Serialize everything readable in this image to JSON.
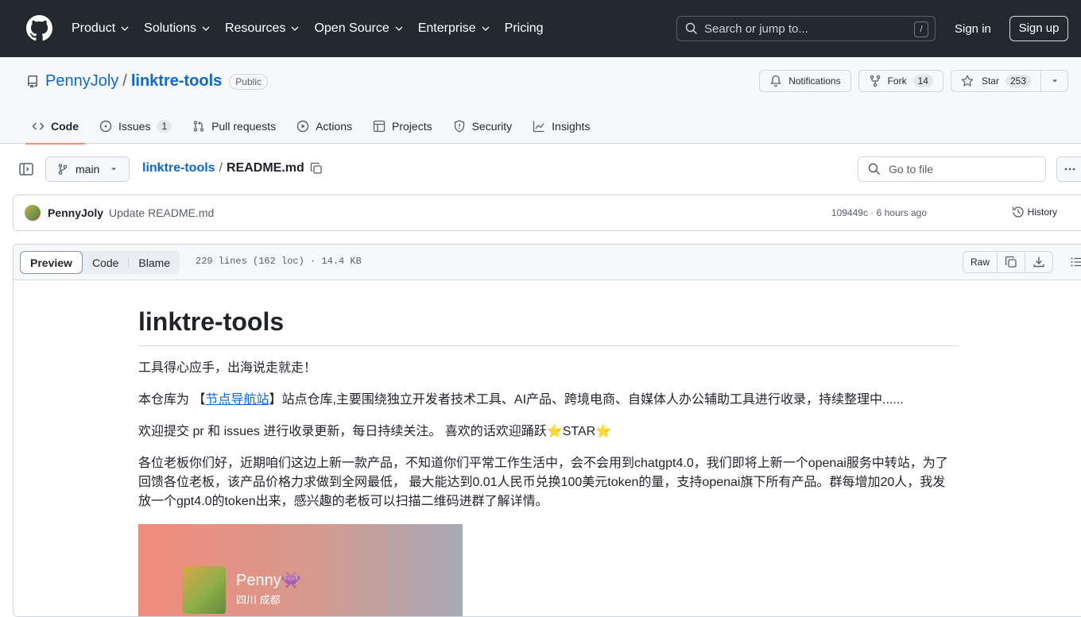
{
  "header": {
    "nav": [
      "Product",
      "Solutions",
      "Resources",
      "Open Source",
      "Enterprise",
      "Pricing"
    ],
    "search_placeholder": "Search or jump to...",
    "search_shortcut": "/",
    "signin": "Sign in",
    "signup": "Sign up"
  },
  "repo": {
    "owner": "PennyJoly",
    "separator": "/",
    "name": "linktre-tools",
    "visibility": "Public",
    "notifications_label": "Notifications",
    "fork_label": "Fork",
    "fork_count": "14",
    "star_label": "Star",
    "star_count": "253"
  },
  "tabs": [
    {
      "label": "Code",
      "icon": "code-icon"
    },
    {
      "label": "Issues",
      "icon": "issue-icon",
      "count": "1"
    },
    {
      "label": "Pull requests",
      "icon": "pull-request-icon"
    },
    {
      "label": "Actions",
      "icon": "play-icon"
    },
    {
      "label": "Projects",
      "icon": "table-icon"
    },
    {
      "label": "Security",
      "icon": "shield-icon"
    },
    {
      "label": "Insights",
      "icon": "graph-icon"
    }
  ],
  "file_nav": {
    "branch": "main",
    "repo_link": "linktre-tools",
    "separator": "/",
    "file_name": "README.md",
    "goto_placeholder": "Go to file"
  },
  "commit": {
    "author": "PennyJoly",
    "message": "Update README.md",
    "meta": "109449c · 6 hours ago",
    "history": "History"
  },
  "file_header": {
    "views": [
      "Preview",
      "Code",
      "Blame"
    ],
    "info": "229 lines (162 loc) · 14.4 KB",
    "raw": "Raw"
  },
  "readme": {
    "title": "linktre-tools",
    "p1": "工具得心应手，出海说走就走！",
    "p2_prefix": "本仓库为 【",
    "p2_link": "节点导航站",
    "p2_suffix": "】站点仓库,主要围绕独立开发者技术工具、AI产品、跨境电商、自媒体人办公辅助工具进行收录，持续整理中......",
    "p3": "欢迎提交 pr 和 issues 进行收录更新，每日持续关注。 喜欢的话欢迎踊跃⭐️STAR⭐️",
    "p4": "各位老板你们好，近期咱们这边上新一款产品，不知道你们平常工作生活中，会不会用到chatgpt4.0，我们即将上新一个openai服务中转站，为了回馈各位老板，该产品价格力求做到全网最低， 最大能达到0.01人民币兑换100美元token的量，支持openai旗下所有产品。群每增加20人，我发放一个gpt4.0的token出来，感兴趣的老板可以扫描二维码进群了解详情。",
    "card_name": "Penny👾",
    "card_location": "四川 成都"
  }
}
